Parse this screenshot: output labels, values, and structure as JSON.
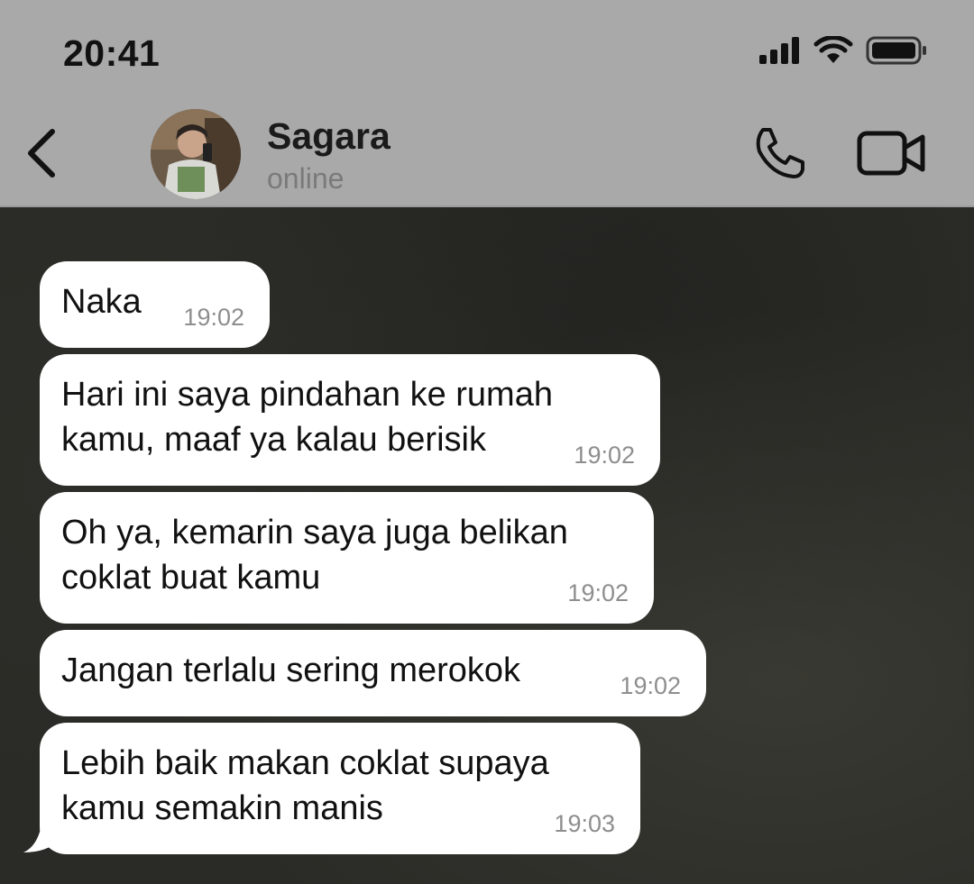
{
  "status_bar": {
    "time": "20:41",
    "signal_icon": "cellular-signal-icon",
    "wifi_icon": "wifi-icon",
    "battery_icon": "battery-full-icon"
  },
  "header": {
    "back_icon": "chevron-left-icon",
    "contact_name": "Sagara",
    "contact_status": "online",
    "call_icon": "phone-icon",
    "video_icon": "video-camera-icon"
  },
  "messages": [
    {
      "text": "Naka",
      "time": "19:02"
    },
    {
      "text": "Hari ini saya pindahan ke rumah\nkamu, maaf ya kalau berisik",
      "time": "19:02"
    },
    {
      "text": "Oh ya, kemarin saya juga belikan\ncoklat buat kamu",
      "time": "19:02"
    },
    {
      "text": "Jangan terlalu sering merokok",
      "time": "19:02"
    },
    {
      "text": "Lebih baik makan coklat supaya\nkamu semakin manis",
      "time": "19:03"
    }
  ],
  "colors": {
    "header_bg": "#a9a9a9",
    "bubble_bg": "#ffffff",
    "chat_bg": "#2a2a26"
  }
}
